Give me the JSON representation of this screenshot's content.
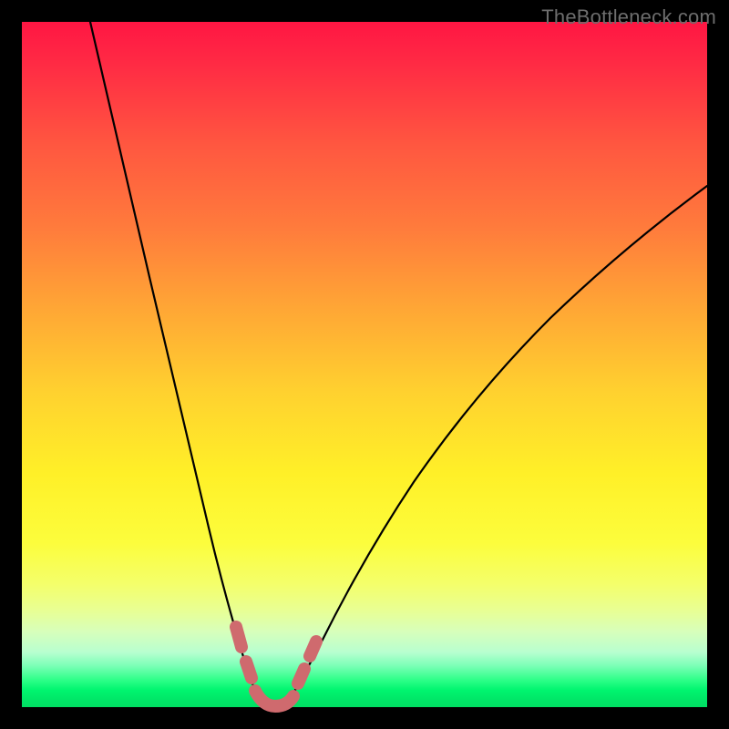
{
  "watermark": "TheBottleneck.com",
  "colors": {
    "gradient_top": "#ff1643",
    "gradient_mid1": "#ff7b3c",
    "gradient_mid2": "#fff028",
    "gradient_bottom": "#00df63",
    "frame_border": "#000000",
    "curve_stroke": "#000000",
    "highlight_stroke": "#cf6a6e",
    "watermark_color": "#6d6d6d"
  },
  "chart_data": {
    "type": "line",
    "title": "",
    "xlabel": "",
    "ylabel": "",
    "xlim": [
      0,
      100
    ],
    "ylim": [
      0,
      100
    ],
    "grid": false,
    "legend": false,
    "series": [
      {
        "name": "left-branch",
        "x": [
          10,
          12,
          14,
          16,
          18,
          20,
          22,
          24,
          26,
          28,
          30,
          31.5,
          33
        ],
        "y": [
          100,
          90,
          80,
          70,
          60,
          50,
          40,
          30,
          21,
          13,
          6,
          2,
          0
        ]
      },
      {
        "name": "right-branch",
        "x": [
          36,
          38,
          41,
          45,
          50,
          56,
          63,
          71,
          80,
          90,
          100
        ],
        "y": [
          0,
          3,
          8,
          15,
          24,
          33,
          43,
          53,
          62,
          71,
          79
        ]
      },
      {
        "name": "valley-floor",
        "x": [
          33,
          34.5,
          36
        ],
        "y": [
          0,
          0,
          0
        ]
      }
    ],
    "highlight": {
      "name": "pink-dots-region",
      "note": "thicker salmon markers over the green band near valley",
      "left_x_range": [
        28,
        31
      ],
      "right_x_range": [
        37,
        40
      ],
      "floor_x_range": [
        31,
        38
      ],
      "y_range": [
        0,
        12
      ]
    },
    "note": "Axes unlabeled in source image; values are normalized 0–100 estimates read from pixel positions."
  }
}
